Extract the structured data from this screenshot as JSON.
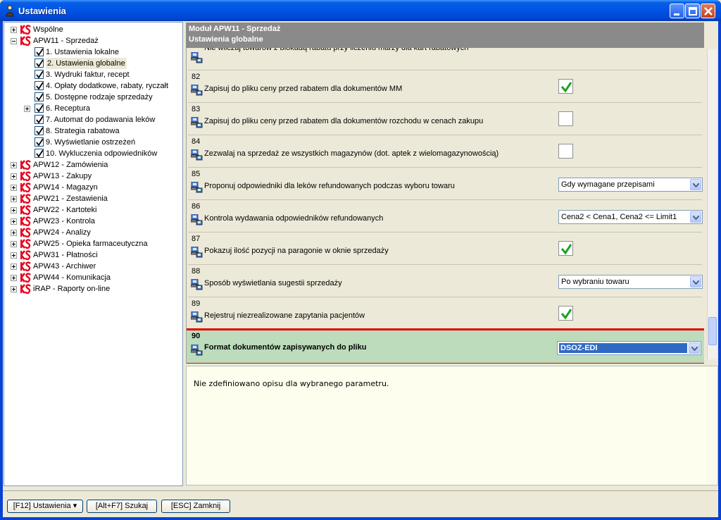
{
  "window": {
    "title": "Ustawienia"
  },
  "tree": {
    "items": [
      {
        "label": "Wspólne",
        "level": 0,
        "type": "ks"
      },
      {
        "label": "APW11 - Sprzedaż",
        "level": 0,
        "type": "ks",
        "expanded": true
      },
      {
        "label": "1. Ustawienia lokalne",
        "level": 1,
        "type": "check"
      },
      {
        "label": "2. Ustawienia globalne",
        "level": 1,
        "type": "check",
        "selected": true
      },
      {
        "label": "3. Wydruki faktur, recept",
        "level": 1,
        "type": "check"
      },
      {
        "label": "4. Opłaty dodatkowe, rabaty, ryczałt",
        "level": 1,
        "type": "check"
      },
      {
        "label": "5. Dostępne rodzaje sprzedaży",
        "level": 1,
        "type": "check"
      },
      {
        "label": "6. Receptura",
        "level": 1,
        "type": "check",
        "expandable": true
      },
      {
        "label": "7. Automat do podawania leków",
        "level": 1,
        "type": "check"
      },
      {
        "label": "8. Strategia rabatowa",
        "level": 1,
        "type": "check"
      },
      {
        "label": "9. Wyświetlanie ostrzeżeń",
        "level": 1,
        "type": "check"
      },
      {
        "label": "10. Wykluczenia odpowiedników",
        "level": 1,
        "type": "check"
      },
      {
        "label": "APW12 - Zamówienia",
        "level": 0,
        "type": "ks"
      },
      {
        "label": "APW13 - Zakupy",
        "level": 0,
        "type": "ks"
      },
      {
        "label": "APW14 - Magazyn",
        "level": 0,
        "type": "ks"
      },
      {
        "label": "APW21 - Zestawienia",
        "level": 0,
        "type": "ks"
      },
      {
        "label": "APW22 - Kartoteki",
        "level": 0,
        "type": "ks"
      },
      {
        "label": "APW23 - Kontrola",
        "level": 0,
        "type": "ks"
      },
      {
        "label": "APW24 - Analizy",
        "level": 0,
        "type": "ks"
      },
      {
        "label": "APW25 - Opieka farmaceutyczna",
        "level": 0,
        "type": "ks"
      },
      {
        "label": "APW31 - Płatności",
        "level": 0,
        "type": "ks"
      },
      {
        "label": "APW43 - Archiwer",
        "level": 0,
        "type": "ks"
      },
      {
        "label": "APW44 - Komunikacja",
        "level": 0,
        "type": "ks"
      },
      {
        "label": "iRAP - Raporty on-line",
        "level": 0,
        "type": "ks"
      }
    ]
  },
  "panel": {
    "module_title": "Moduł APW11 - Sprzedaż",
    "section_title": "Ustawienia globalne"
  },
  "params": [
    {
      "num": "",
      "label": "Nie wliczaj towarów z blokadą rabatu przy liczeniu marży dla kart rabatowych",
      "control": "checkbox",
      "checked": false,
      "partial": true
    },
    {
      "num": "82",
      "label": "Zapisuj do pliku ceny przed rabatem dla dokumentów MM",
      "control": "checkbox",
      "checked": true
    },
    {
      "num": "83",
      "label": "Zapisuj do pliku ceny przed rabatem dla dokumentów rozchodu w cenach zakupu",
      "control": "checkbox",
      "checked": false
    },
    {
      "num": "84",
      "label": "Zezwalaj na sprzedaż ze wszystkich magazynów (dot. aptek z wielomagazynowością)",
      "control": "checkbox",
      "checked": false
    },
    {
      "num": "85",
      "label": "Proponuj odpowiedniki dla leków refundowanych podczas wyboru towaru",
      "control": "dropdown",
      "value": "Gdy wymagane przepisami"
    },
    {
      "num": "86",
      "label": "Kontrola wydawania odpowiedników refundowanych",
      "control": "dropdown",
      "value": "Cena2 < Cena1, Cena2 <= Limit1"
    },
    {
      "num": "87",
      "label": "Pokazuj ilość pozycji na paragonie w oknie sprzedaży",
      "control": "checkbox",
      "checked": true
    },
    {
      "num": "88",
      "label": "Sposób wyświetlania sugestii sprzedaży",
      "control": "dropdown",
      "value": "Po wybraniu towaru"
    },
    {
      "num": "89",
      "label": "Rejestruj niezrealizowane zapytania pacjentów",
      "control": "checkbox",
      "checked": true
    },
    {
      "num": "90",
      "label": "Format dokumentów zapisywanych do pliku",
      "control": "dropdown",
      "value": "DSOZ-EDI",
      "highlighted": true
    }
  ],
  "description": {
    "text": "Nie zdefiniowano opisu dla wybranego parametru."
  },
  "footer": {
    "settings_label": "[F12] Ustawienia",
    "search_label": "[Alt+F7] Szukaj",
    "close_label": "[ESC] Zamknij"
  },
  "colors": {
    "titlebar": "#0055e5",
    "highlight_row": "#bcdcbc",
    "highlight_border": "#e60000",
    "panel_header": "#8a8a8a",
    "check_green": "#21a121"
  }
}
